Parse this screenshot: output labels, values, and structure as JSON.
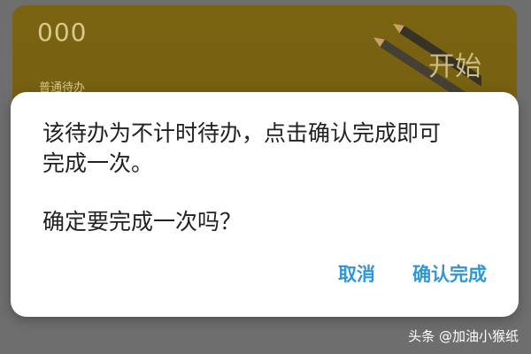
{
  "card": {
    "count": "000",
    "type_label": "普通待办",
    "start_label": "开始"
  },
  "dialog": {
    "message_line1": "该待办为不计时待办，点击确认完成即可",
    "message_line2": "完成一次。",
    "question": "确定要完成一次吗？",
    "cancel_label": "取消",
    "confirm_label": "确认完成"
  },
  "watermark": {
    "text": "头条 @加油小猴纸"
  },
  "colors": {
    "card_bg": "#7a6412",
    "accent": "#2f97d8",
    "overlay_bg": "#6e6e6e"
  },
  "icons": {
    "card_art": "pencil-icon"
  }
}
